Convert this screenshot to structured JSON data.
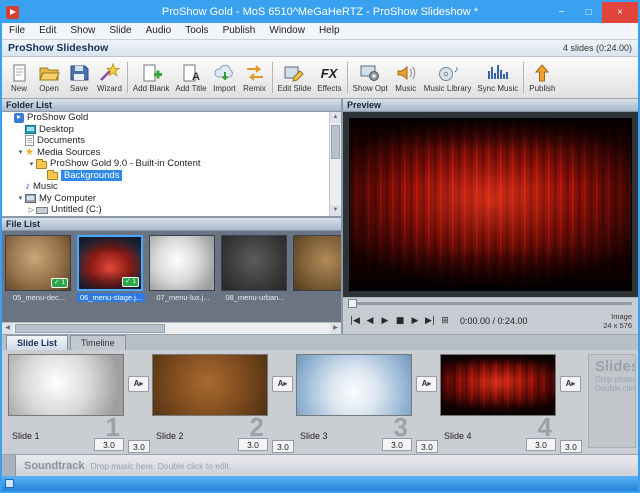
{
  "window": {
    "title": "ProShow Gold - MoS 6510^MeGaHeRTZ - ProShow Slideshow *",
    "controls": {
      "minimize": "−",
      "maximize": "□",
      "close": "×"
    }
  },
  "menu": {
    "items": [
      "File",
      "Edit",
      "Show",
      "Slide",
      "Audio",
      "Tools",
      "Publish",
      "Window",
      "Help"
    ]
  },
  "header": {
    "title": "ProShow Slideshow",
    "slide_count": "4 slides (0:24.00)"
  },
  "toolbar": {
    "items": [
      {
        "label": "New"
      },
      {
        "label": "Open"
      },
      {
        "label": "Save"
      },
      {
        "label": "Wizard"
      },
      {
        "label": "Add Blank"
      },
      {
        "label": "Add Title"
      },
      {
        "label": "Import"
      },
      {
        "label": "Remix"
      },
      {
        "label": "Edit Slide"
      },
      {
        "label": "Effects"
      },
      {
        "label": "Show Opt"
      },
      {
        "label": "Music"
      },
      {
        "label": "Music Library"
      },
      {
        "label": "Sync Music"
      },
      {
        "label": "Publish"
      }
    ]
  },
  "folder_panel": {
    "title": "Folder List",
    "tree": [
      {
        "label": "ProShow Gold"
      },
      {
        "label": "Desktop"
      },
      {
        "label": "Documents"
      },
      {
        "label": "Media Sources"
      },
      {
        "label": "ProShow Gold 9.0 - Built-in Content"
      },
      {
        "label": "Backgrounds"
      },
      {
        "label": "Music"
      },
      {
        "label": "My Computer"
      },
      {
        "label": "Untitled (C:)"
      }
    ]
  },
  "file_panel": {
    "title": "File List",
    "files": [
      {
        "name": "05_menu-dec...",
        "badge": "✓ 1"
      },
      {
        "name": "06_menu-stage.j...",
        "badge": "✓ 1"
      },
      {
        "name": "07_menu-lux.j...",
        "badge": ""
      },
      {
        "name": "08_menu-urban...",
        "badge": ""
      },
      {
        "name": "",
        "badge": ""
      }
    ]
  },
  "preview": {
    "title": "Preview",
    "transport": [
      {
        "glyph": "|◀"
      },
      {
        "glyph": "◀"
      },
      {
        "glyph": "▶"
      },
      {
        "glyph": "■"
      },
      {
        "glyph": "▶"
      },
      {
        "glyph": "▶|"
      },
      {
        "glyph": "⊞"
      }
    ],
    "time": "0:00.00 / 0:24.00",
    "info_top": "Image",
    "info_bottom": "24 x 576"
  },
  "bottom": {
    "tabs": [
      "Slide List",
      "Timeline"
    ],
    "slides": [
      {
        "name": "Slide 1",
        "number": "1",
        "time": "3.0",
        "transition_time": "3.0"
      },
      {
        "name": "Slide 2",
        "number": "2",
        "time": "3.0",
        "transition_time": "3.0"
      },
      {
        "name": "Slide 3",
        "number": "3",
        "time": "3.0",
        "transition_time": "3.0"
      },
      {
        "name": "Slide 4",
        "number": "4",
        "time": "3.0",
        "transition_time": "3.0"
      }
    ],
    "drop": {
      "title": "Slides",
      "line1": "Drop photo /",
      "line2": "Double click to"
    },
    "soundtrack": {
      "label": "Soundtrack",
      "hint": "Drop music here. Double click to edit."
    }
  }
}
